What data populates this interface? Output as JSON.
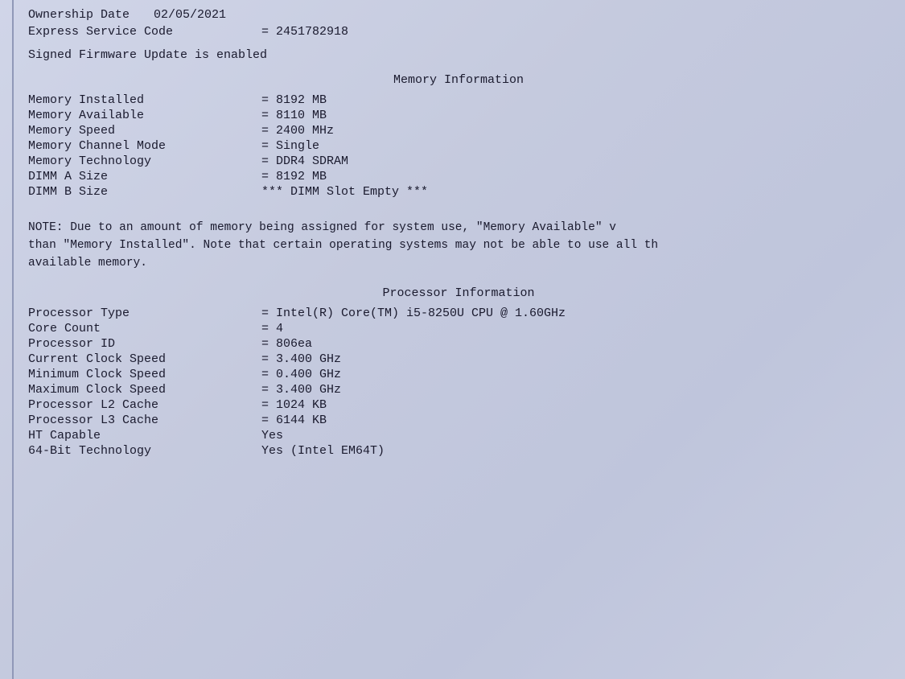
{
  "header": {
    "express_service_code_label": "Express Service Code",
    "express_service_code_value": "= 2451782918",
    "ownership_date_label": "Ownership Date",
    "ownership_date_value": "02/05/2021"
  },
  "firmware": {
    "text": "Signed Firmware Update is enabled"
  },
  "memory_section": {
    "title": "Memory Information",
    "rows": [
      {
        "label": "Memory Installed",
        "value": "= 8192 MB"
      },
      {
        "label": "Memory Available",
        "value": "= 8110 MB"
      },
      {
        "label": "Memory Speed",
        "value": "= 2400 MHz"
      },
      {
        "label": "Memory Channel Mode",
        "value": "= Single"
      },
      {
        "label": "Memory Technology",
        "value": "= DDR4 SDRAM"
      },
      {
        "label": "DIMM A Size",
        "value": "= 8192 MB"
      },
      {
        "label": "DIMM B Size",
        "value": "*** DIMM Slot Empty ***"
      }
    ]
  },
  "memory_note": {
    "line1": "NOTE: Due to an amount of memory being assigned for system use, \"Memory Available\" v",
    "line2": "than \"Memory Installed\". Note that certain operating systems may not be able to use all th",
    "line3": "available memory."
  },
  "processor_section": {
    "title": "Processor Information",
    "rows": [
      {
        "label": "Processor Type",
        "value": "= Intel(R) Core(TM) i5-8250U CPU @ 1.60GHz"
      },
      {
        "label": "Core Count",
        "value": "= 4"
      },
      {
        "label": "Processor ID",
        "value": "= 806ea"
      },
      {
        "label": "Current Clock Speed",
        "value": "= 3.400 GHz"
      },
      {
        "label": "Minimum Clock Speed",
        "value": "= 0.400 GHz"
      },
      {
        "label": "Maximum Clock Speed",
        "value": "= 3.400 GHz"
      },
      {
        "label": "Processor L2 Cache",
        "value": "= 1024 KB"
      },
      {
        "label": "Processor L3 Cache",
        "value": "= 6144 KB"
      },
      {
        "label": "HT Capable",
        "value": "Yes"
      },
      {
        "label": "64-Bit Technology",
        "value": "Yes (Intel EM64T)"
      }
    ]
  }
}
